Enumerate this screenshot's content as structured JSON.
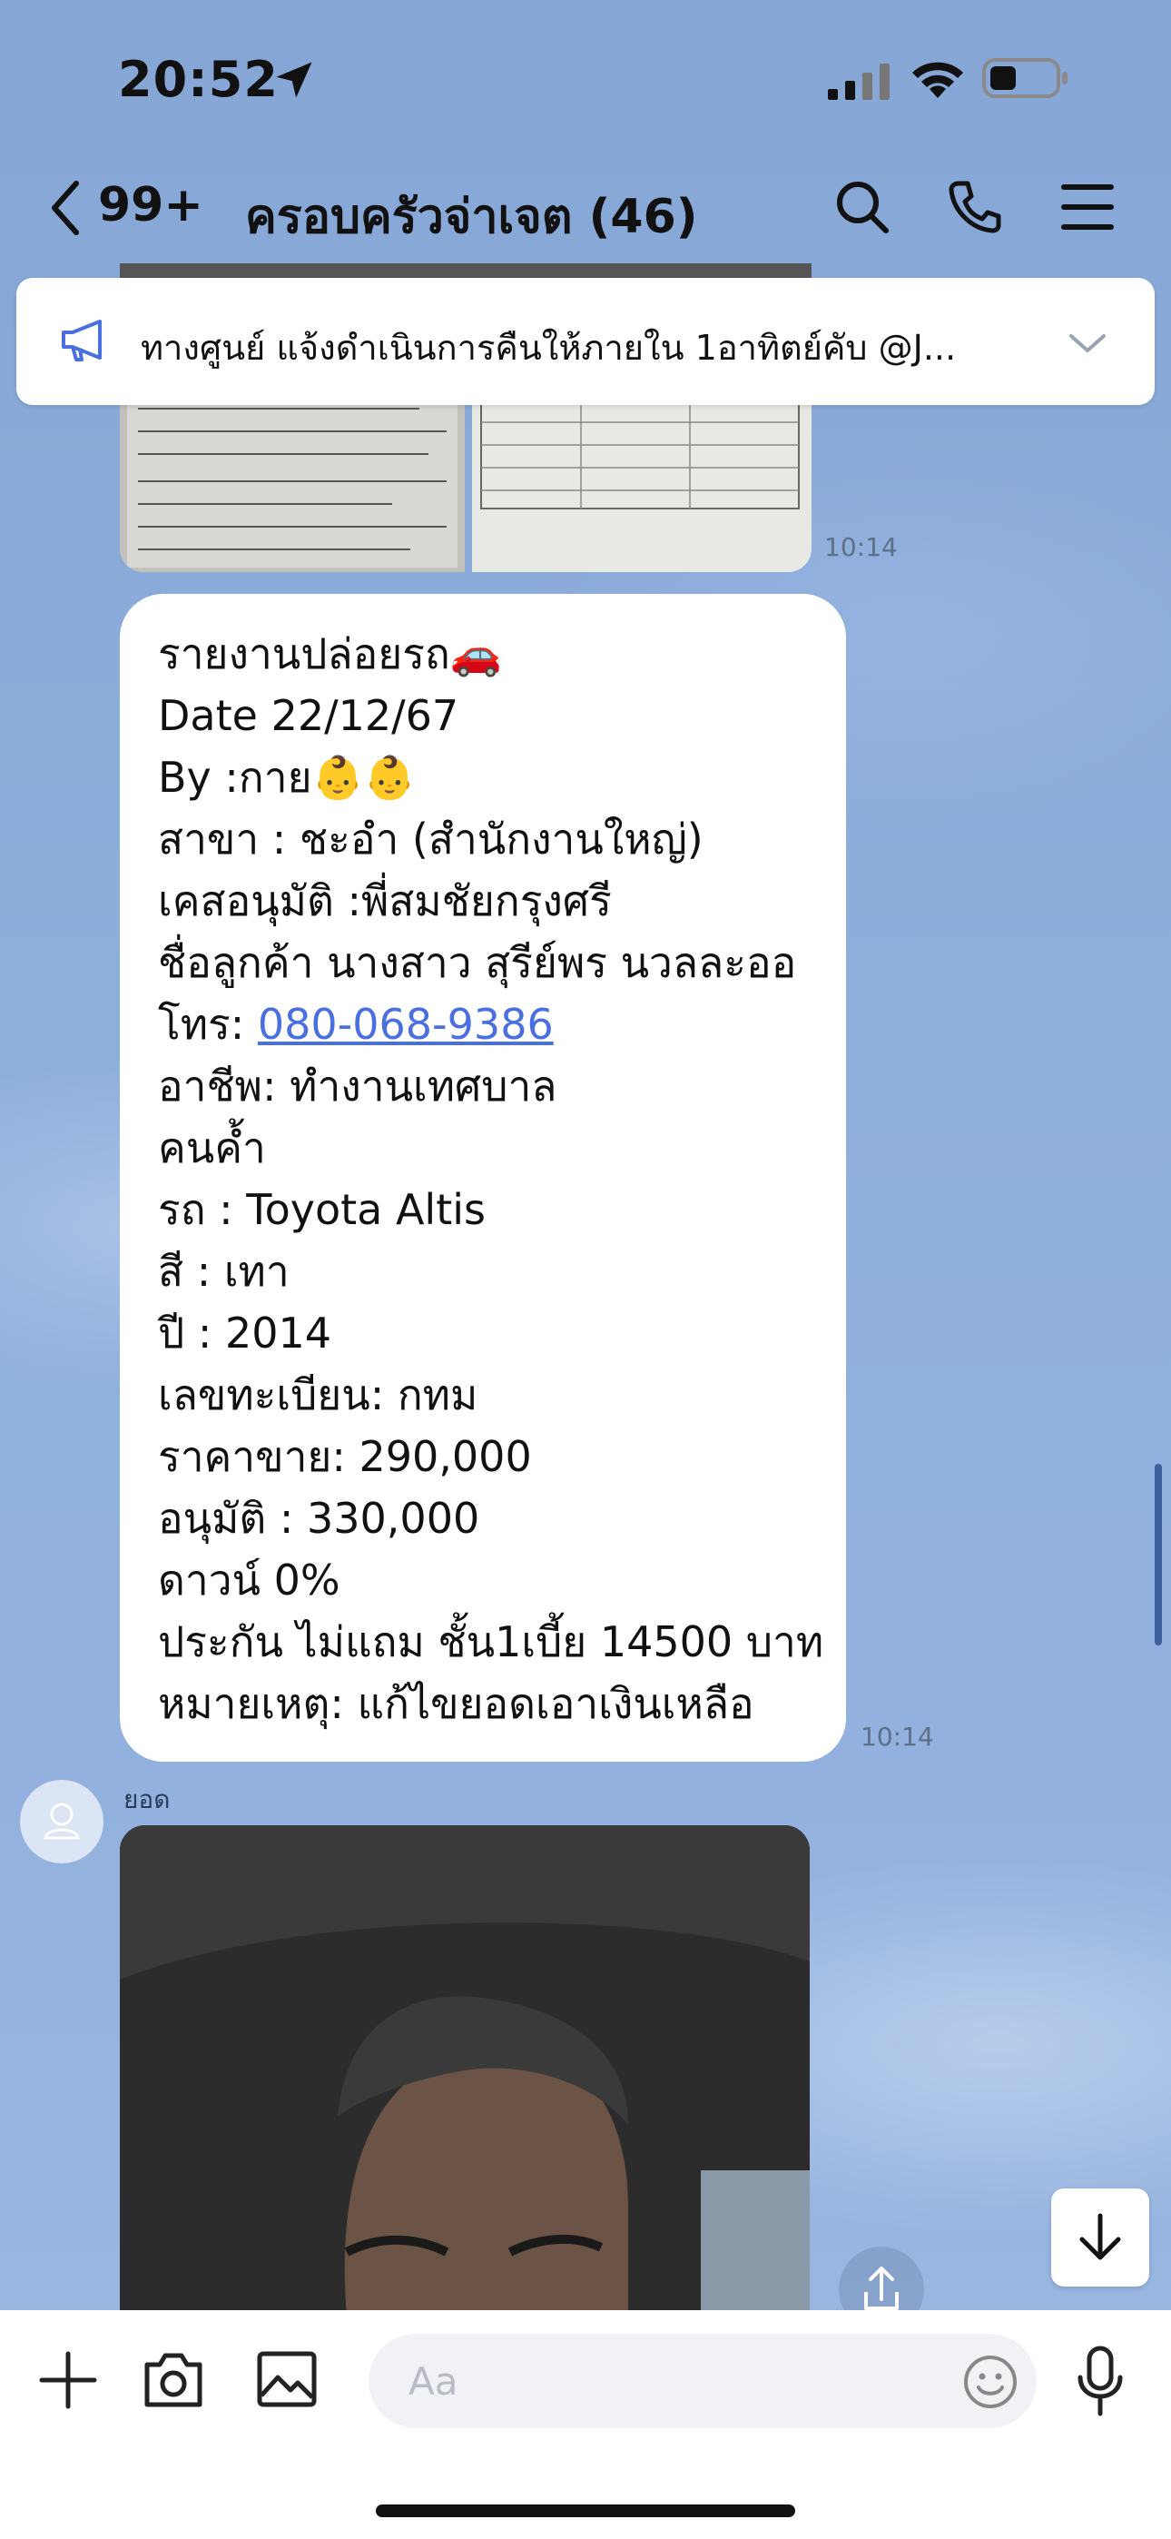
{
  "status_bar": {
    "time": "20:52"
  },
  "header": {
    "unread_count": "99+",
    "title": "ครอบครัวจ่าเจต (46)"
  },
  "announcement": {
    "text": "ทางศูนย์ แจ้งดำเนินการคืนให้ภายใน 1อาทิตย์คับ @J..."
  },
  "image_message": {
    "time": "10:14"
  },
  "text_message": {
    "time": "10:14",
    "lines": [
      "รายงานปล่อยรถ🚗",
      "Date 22/12/67",
      "By :กาย👶👶",
      "สาขา : ชะอำ (สำนักงานใหญ่)",
      "เคสอนุมัติ :พี่สมชัยกรุงศรี",
      "ชื่อลูกค้า นางสาว สุรีย์พร นวลละออ",
      "อาชีพ: ทำงานเทศบาล",
      "คนค้ำ",
      "รถ : Toyota Altis",
      "สี : เทา",
      "ปี : 2014",
      "เลขทะเบียน: กทม",
      "ราคาขาย: 290,000",
      "อนุมัติ : 330,000",
      "ดาวน์ 0%",
      "ประกัน ไม่แถม ชั้น1เบี้ย 14500 บาท",
      "หมายเหตุ: แก้ไขยอดเอาเงินเหลือ"
    ],
    "phone_label": "โทร: ",
    "phone_number": "080-068-9386"
  },
  "sender": {
    "name": "ยอด"
  },
  "composer": {
    "placeholder": "Aa"
  },
  "colors": {
    "link": "#4a6fe0",
    "accent": "#4a6fe0",
    "chat_bg": "#8eabd9"
  },
  "icons": [
    "location-arrow-icon",
    "signal-icon",
    "wifi-icon",
    "battery-icon",
    "back-icon",
    "search-icon",
    "phone-icon",
    "menu-icon",
    "megaphone-icon",
    "chevron-down-icon",
    "avatar-icon",
    "share-icon",
    "arrow-down-icon",
    "plus-icon",
    "camera-icon",
    "image-icon",
    "emoji-icon",
    "mic-icon"
  ]
}
